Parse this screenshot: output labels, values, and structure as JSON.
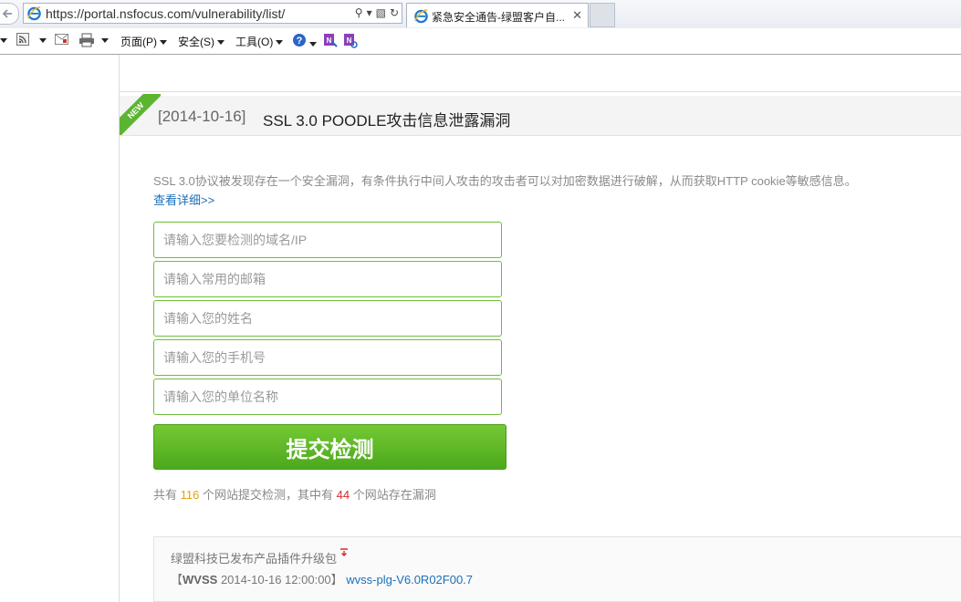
{
  "browser": {
    "url": "https://portal.nsfocus.com/vulnerability/list/",
    "tab_title": "紧急安全通告-绿盟客户自...",
    "commands": {
      "page": "页面(P)",
      "safety": "安全(S)",
      "tools": "工具(O)"
    }
  },
  "advisory": {
    "badge": "NEW",
    "date": "[2014-10-16]",
    "title": "SSL 3.0 POODLE攻击信息泄露漏洞",
    "description": "SSL 3.0协议被发现存在一个安全漏洞，有条件执行中间人攻击的攻击者可以对加密数据进行破解，从而获取HTTP cookie等敏感信息。",
    "more_link": "查看详细>>"
  },
  "form": {
    "domain_placeholder": "请输入您要检测的域名/IP",
    "email_placeholder": "请输入常用的邮箱",
    "name_placeholder": "请输入您的姓名",
    "phone_placeholder": "请输入您的手机号",
    "company_placeholder": "请输入您的单位名称",
    "submit_label": "提交检测"
  },
  "stats": {
    "prefix": "共有",
    "submitted_count": "116",
    "middle": "个网站提交检测，其中有",
    "vulnerable_count": "44",
    "suffix": "个网站存在漏洞"
  },
  "news": {
    "headline": "绿盟科技已发布产品插件升级包",
    "bracket_open": "【",
    "product": "WVSS",
    "timestamp": "2014-10-16 12:00:00",
    "bracket_close": "】",
    "package_link": "wvss-plg-V6.0R02F00.7"
  },
  "colors": {
    "accent_green": "#5cb531",
    "link_blue": "#1a6fb8",
    "count_orange": "#e2a10e",
    "count_red": "#d92b2b"
  }
}
